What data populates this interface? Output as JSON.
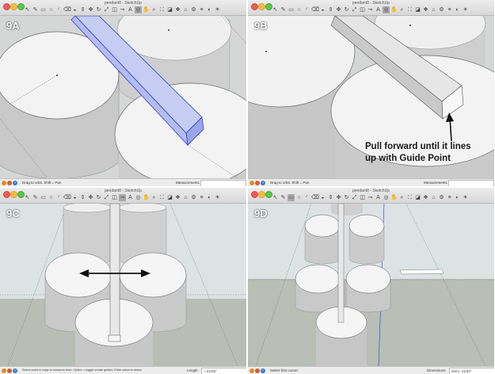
{
  "panels": [
    {
      "id": "9A",
      "label": "9A",
      "window_title": "pendant8 - SketchUp",
      "status_hint": "Drag to orbit.  Shift = Pan",
      "measurements_label": "Measurements",
      "measurements_value": ""
    },
    {
      "id": "9B",
      "label": "9B",
      "window_title": "pendant8 - SketchUp",
      "status_hint": "Drag to orbit.  Shift = Pan",
      "measurements_label": "Measurements",
      "measurements_value": "",
      "callout": "Pull forward until it lines up with Guide Point",
      "callout_line1": "Pull forward until it lines",
      "callout_line2": "up with Guide Point"
    },
    {
      "id": "9C",
      "label": "9C",
      "window_title": "pendant8 - SketchUp",
      "status_hint": "Select point or edge to measure from.  Option = toggle create guides.  Enter value to resize",
      "measurements_label": "Length",
      "measurements_value": "~ 21/32\""
    },
    {
      "id": "9D",
      "label": "9D",
      "window_title": "pendant8 - SketchUp",
      "status_hint": "Select first corner.",
      "measurements_label": "Dimensions",
      "measurements_value": "2mm, 21/32\""
    }
  ],
  "toolbar_icons": [
    "select-arrow",
    "pencil",
    "rectangle",
    "circle",
    "arc",
    "eraser",
    "paint-bucket",
    "push-pull",
    "move",
    "rotate",
    "scale",
    "offset",
    "tape-measure",
    "text",
    "orbit",
    "pan",
    "zoom",
    "zoom-extents",
    "section",
    "components",
    "warehouse",
    "extension",
    "layers",
    "styles",
    "shadows"
  ],
  "colors": {
    "sky": "#dfe4e7",
    "ground": "#b7bcb5",
    "cylinder_top": "#f2f2f2",
    "selection_blue": "#2b3bdb",
    "traffic_red": "#ee5b55",
    "traffic_yellow": "#f6bd3c",
    "traffic_green": "#5bc84b"
  }
}
